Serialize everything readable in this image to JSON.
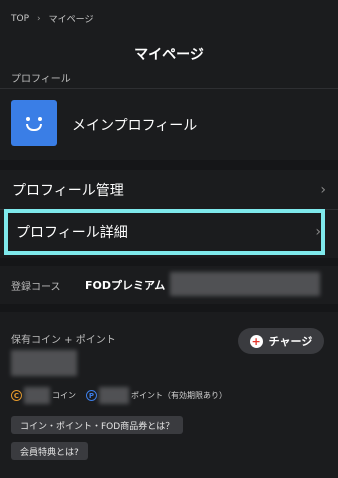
{
  "breadcrumb": {
    "top": "TOP",
    "current": "マイページ"
  },
  "page_title": "マイページ",
  "profile_section": {
    "label": "プロフィール",
    "name": "メインプロフィール"
  },
  "menu": {
    "manage": "プロフィール管理",
    "detail": "プロフィール詳細"
  },
  "course": {
    "label": "登録コース",
    "value": "FODプレミアム"
  },
  "coins": {
    "label": "保有コイン + ポイント",
    "charge_button": "チャージ",
    "coin_icon_char": "C",
    "coin_unit": "コイン",
    "point_icon_char": "P",
    "point_unit": "ポイント（有効期限あり）",
    "link_coin_info": "コイン・ポイント・FOD商品券とは？",
    "link_member_benefits": "会員特典とは?"
  }
}
